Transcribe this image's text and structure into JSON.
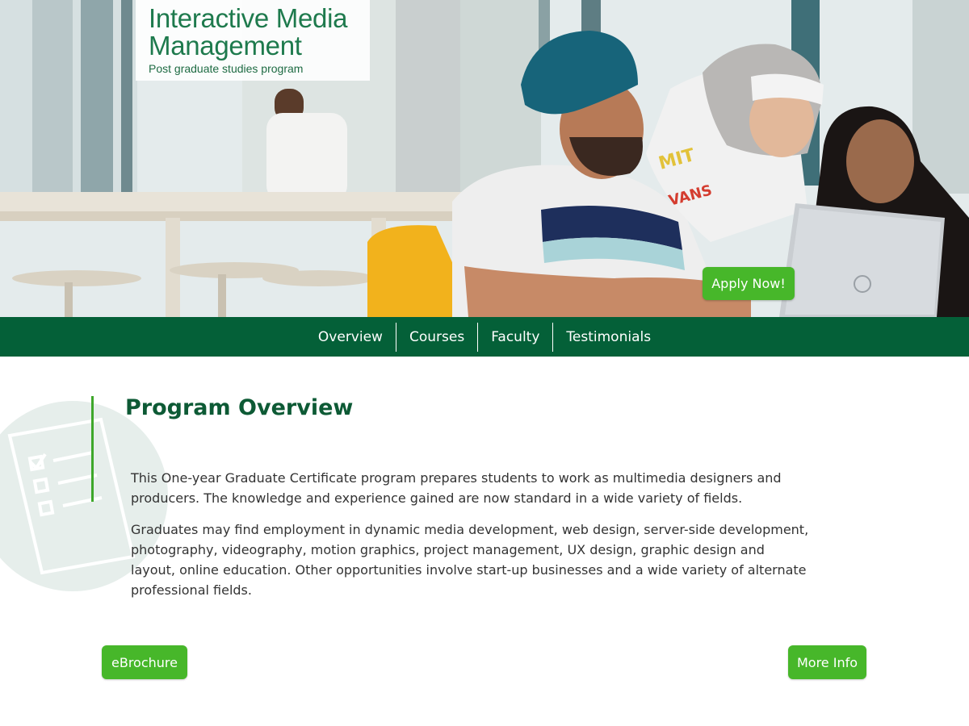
{
  "hero": {
    "title_line1": "Interactive Media",
    "title_line2": "Management",
    "subtitle": "Post graduate studies program",
    "apply_label": "Apply Now!",
    "photo_icon": "students-at-laptop-photo"
  },
  "nav": {
    "items": [
      {
        "label": "Overview"
      },
      {
        "label": "Courses"
      },
      {
        "label": "Faculty"
      },
      {
        "label": "Testimonials"
      }
    ]
  },
  "overview": {
    "heading": "Program Overview",
    "paragraphs": [
      "This One-year Graduate Certificate program prepares students to work as multimedia designers and producers. The knowledge and experience gained are now standard in a wide variety of fields.",
      "Graduates may find employment in dynamic media development, web design, server-side development, photography, videography, motion graphics, project management, UX design, graphic design and layout, online education. Other opportunities involve start-up businesses and a wide variety of alternate professional fields."
    ],
    "decoration_icon": "checklist-icon"
  },
  "actions": {
    "ebrochure_label": "eBrochure",
    "more_info_label": "More Info"
  },
  "colors": {
    "brand_green": "#046038",
    "button_green": "#47b72a",
    "accent_green": "#3ea72b",
    "heading_green": "#0d5a35"
  }
}
